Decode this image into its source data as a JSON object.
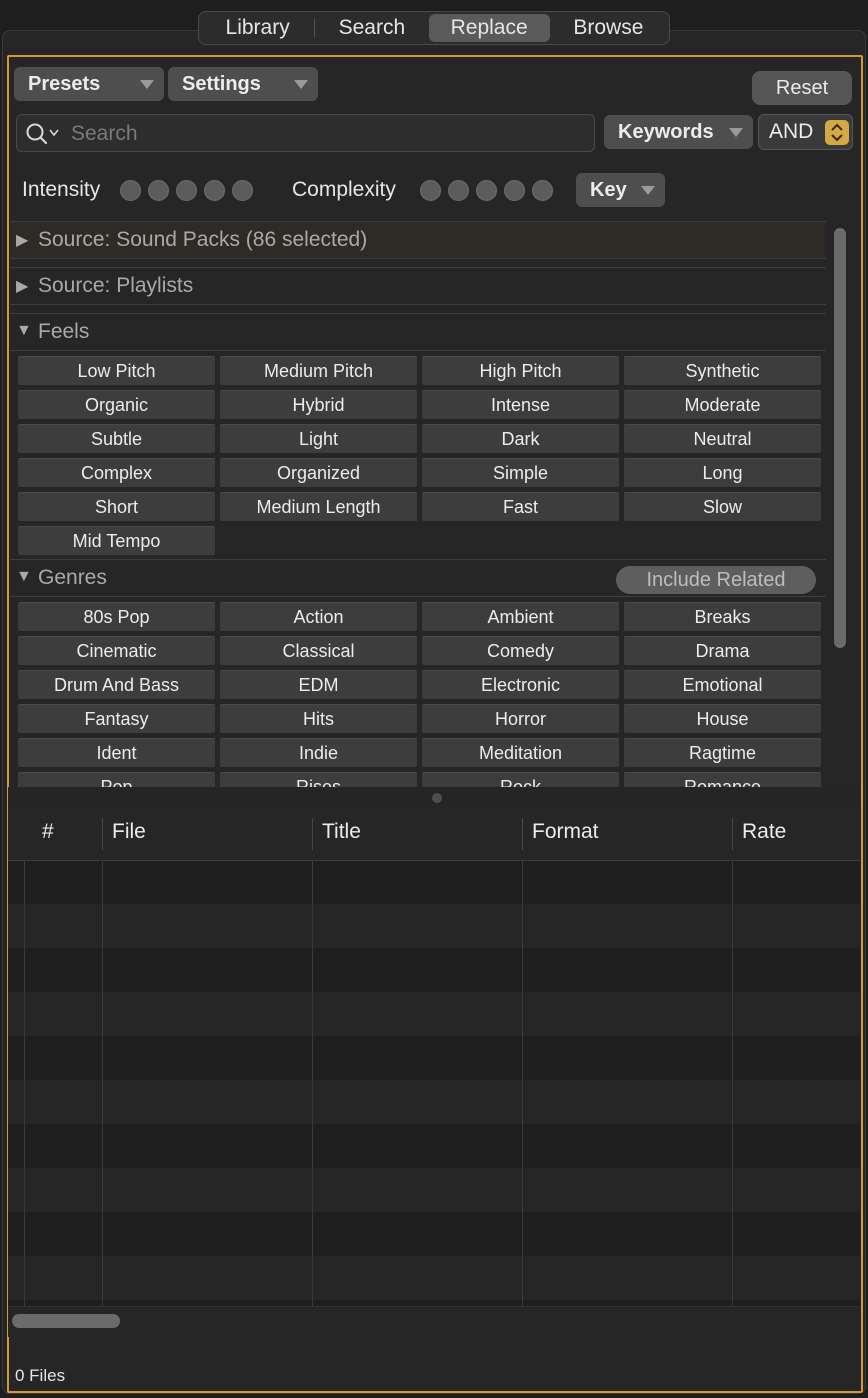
{
  "tabs": [
    "Library",
    "Search",
    "Replace",
    "Browse"
  ],
  "active_tab": "Replace",
  "toolbar": {
    "presets": "Presets",
    "settings": "Settings",
    "reset": "Reset"
  },
  "search": {
    "placeholder": "Search",
    "keywords": "Keywords",
    "operator": "AND"
  },
  "rating": {
    "intensity": "Intensity",
    "complexity": "Complexity",
    "key": "Key"
  },
  "sections": {
    "sound_packs": "Source: Sound Packs (86 selected)",
    "playlists": "Source: Playlists",
    "feels": "Feels",
    "genres": "Genres",
    "include_related": "Include Related"
  },
  "feels": [
    "Low Pitch",
    "Medium Pitch",
    "High Pitch",
    "Synthetic",
    "Organic",
    "Hybrid",
    "Intense",
    "Moderate",
    "Subtle",
    "Light",
    "Dark",
    "Neutral",
    "Complex",
    "Organized",
    "Simple",
    "Long",
    "Short",
    "Medium Length",
    "Fast",
    "Slow",
    "Mid Tempo"
  ],
  "genres": [
    "80s Pop",
    "Action",
    "Ambient",
    "Breaks",
    "Cinematic",
    "Classical",
    "Comedy",
    "Drama",
    "Drum And Bass",
    "EDM",
    "Electronic",
    "Emotional",
    "Fantasy",
    "Hits",
    "Horror",
    "House",
    "Ident",
    "Indie",
    "Meditation",
    "Ragtime",
    "Pop",
    "Rises",
    "Rock",
    "Romance"
  ],
  "table": {
    "columns": [
      "#",
      "File",
      "Title",
      "Format",
      "Rate"
    ]
  },
  "footer": {
    "status": "0 Files"
  },
  "colors": {
    "accent": "#d4973a",
    "stepper": "#d4a843"
  }
}
